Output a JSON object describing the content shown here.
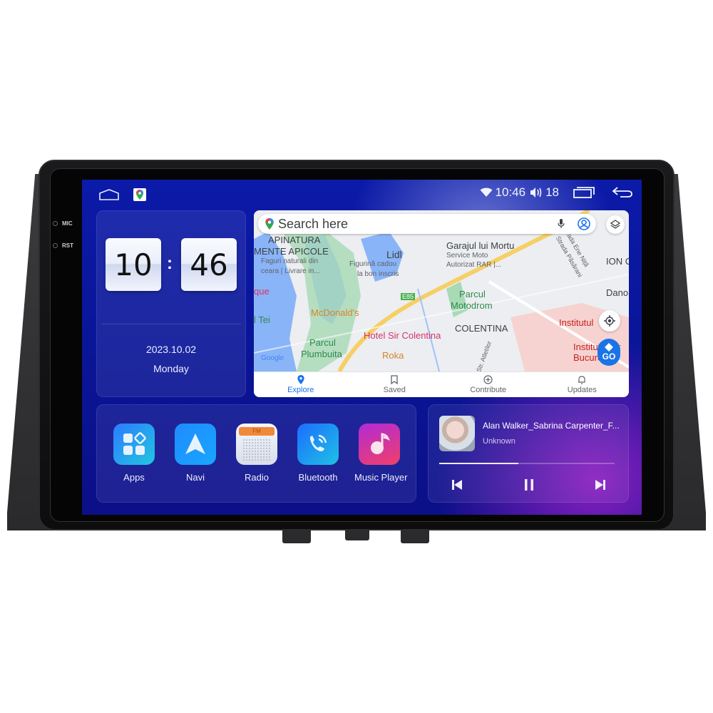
{
  "device": {
    "port_labels": [
      "MIC",
      "RST"
    ]
  },
  "statusbar": {
    "left_icons": [
      "home-icon",
      "google-maps-icon"
    ],
    "time": "10:46",
    "volume": "18",
    "right_icons": [
      "wifi-icon",
      "volume-icon",
      "recent-apps-icon",
      "back-icon"
    ]
  },
  "clock": {
    "hours": "10",
    "minutes": "46",
    "separator": ":",
    "date": "2023.10.02",
    "weekday": "Monday"
  },
  "map": {
    "search_placeholder": "Search here",
    "go_label": "GO",
    "labels": [
      {
        "text": "APINATURA",
        "style": "dark"
      },
      {
        "text": "MENTE APICOLE",
        "style": "dark"
      },
      {
        "text": "Faguri naturali din",
        "style": "small"
      },
      {
        "text": "ceara | Livrare in...",
        "style": "small"
      },
      {
        "text": "Lidl",
        "style": "dark"
      },
      {
        "text": "Figurină cadou",
        "style": "small"
      },
      {
        "text": "la bon inscris",
        "style": "small"
      },
      {
        "text": "Garajul lui Mortu",
        "style": "dark"
      },
      {
        "text": "Service Moto",
        "style": "small"
      },
      {
        "text": "Autorizat RAR |...",
        "style": "small"
      },
      {
        "text": "Parcul",
        "style": "green"
      },
      {
        "text": "Motodrom",
        "style": "green"
      },
      {
        "text": "COLENTINA",
        "style": "dark"
      },
      {
        "text": "McDonald's",
        "style": "orange"
      },
      {
        "text": "Hotel Sir Colentina",
        "style": "pink"
      },
      {
        "text": "Parcul",
        "style": "green"
      },
      {
        "text": "Plumbuita",
        "style": "green"
      },
      {
        "text": "Roka",
        "style": "orange"
      },
      {
        "text": "Institutul",
        "style": "red"
      },
      {
        "text": "Institutul Or",
        "style": "red"
      },
      {
        "text": "București P",
        "style": "red"
      },
      {
        "text": "ION C",
        "style": "dark"
      },
      {
        "text": "Dano",
        "style": "dark"
      },
      {
        "text": "l Tei",
        "style": "green"
      },
      {
        "text": "que",
        "style": "pink"
      },
      {
        "text": "E85",
        "style": "small"
      },
      {
        "text": "Google",
        "style": "small"
      },
      {
        "text": "Strada Ene Niță",
        "style": "small"
      },
      {
        "text": "Strada Păsărani",
        "style": "small"
      },
      {
        "text": "Str. Atletilor",
        "style": "small"
      }
    ],
    "nav": [
      {
        "label": "Explore",
        "icon": "pin-icon",
        "active": true
      },
      {
        "label": "Saved",
        "icon": "bookmark-icon",
        "active": false
      },
      {
        "label": "Contribute",
        "icon": "plus-circle-icon",
        "active": false
      },
      {
        "label": "Updates",
        "icon": "bell-icon",
        "active": false
      }
    ]
  },
  "apps": [
    {
      "label": "Apps",
      "icon": "apps-grid-icon"
    },
    {
      "label": "Navi",
      "icon": "navigation-arrow-icon"
    },
    {
      "label": "Radio",
      "icon": "radio-icon",
      "badge": "FM"
    },
    {
      "label": "Bluetooth",
      "icon": "phone-bluetooth-icon"
    },
    {
      "label": "Music Player",
      "icon": "music-note-icon"
    }
  ],
  "music": {
    "title": "Alan Walker_Sabrina Carpenter_F...",
    "artist": "Unknown",
    "progress_percent": 45,
    "controls": [
      "previous-icon",
      "pause-icon",
      "next-icon"
    ]
  },
  "colors": {
    "screen_blue": "#0b1aa8",
    "music_purple": "#8a1fc0",
    "maps_blue": "#1a73e8"
  }
}
